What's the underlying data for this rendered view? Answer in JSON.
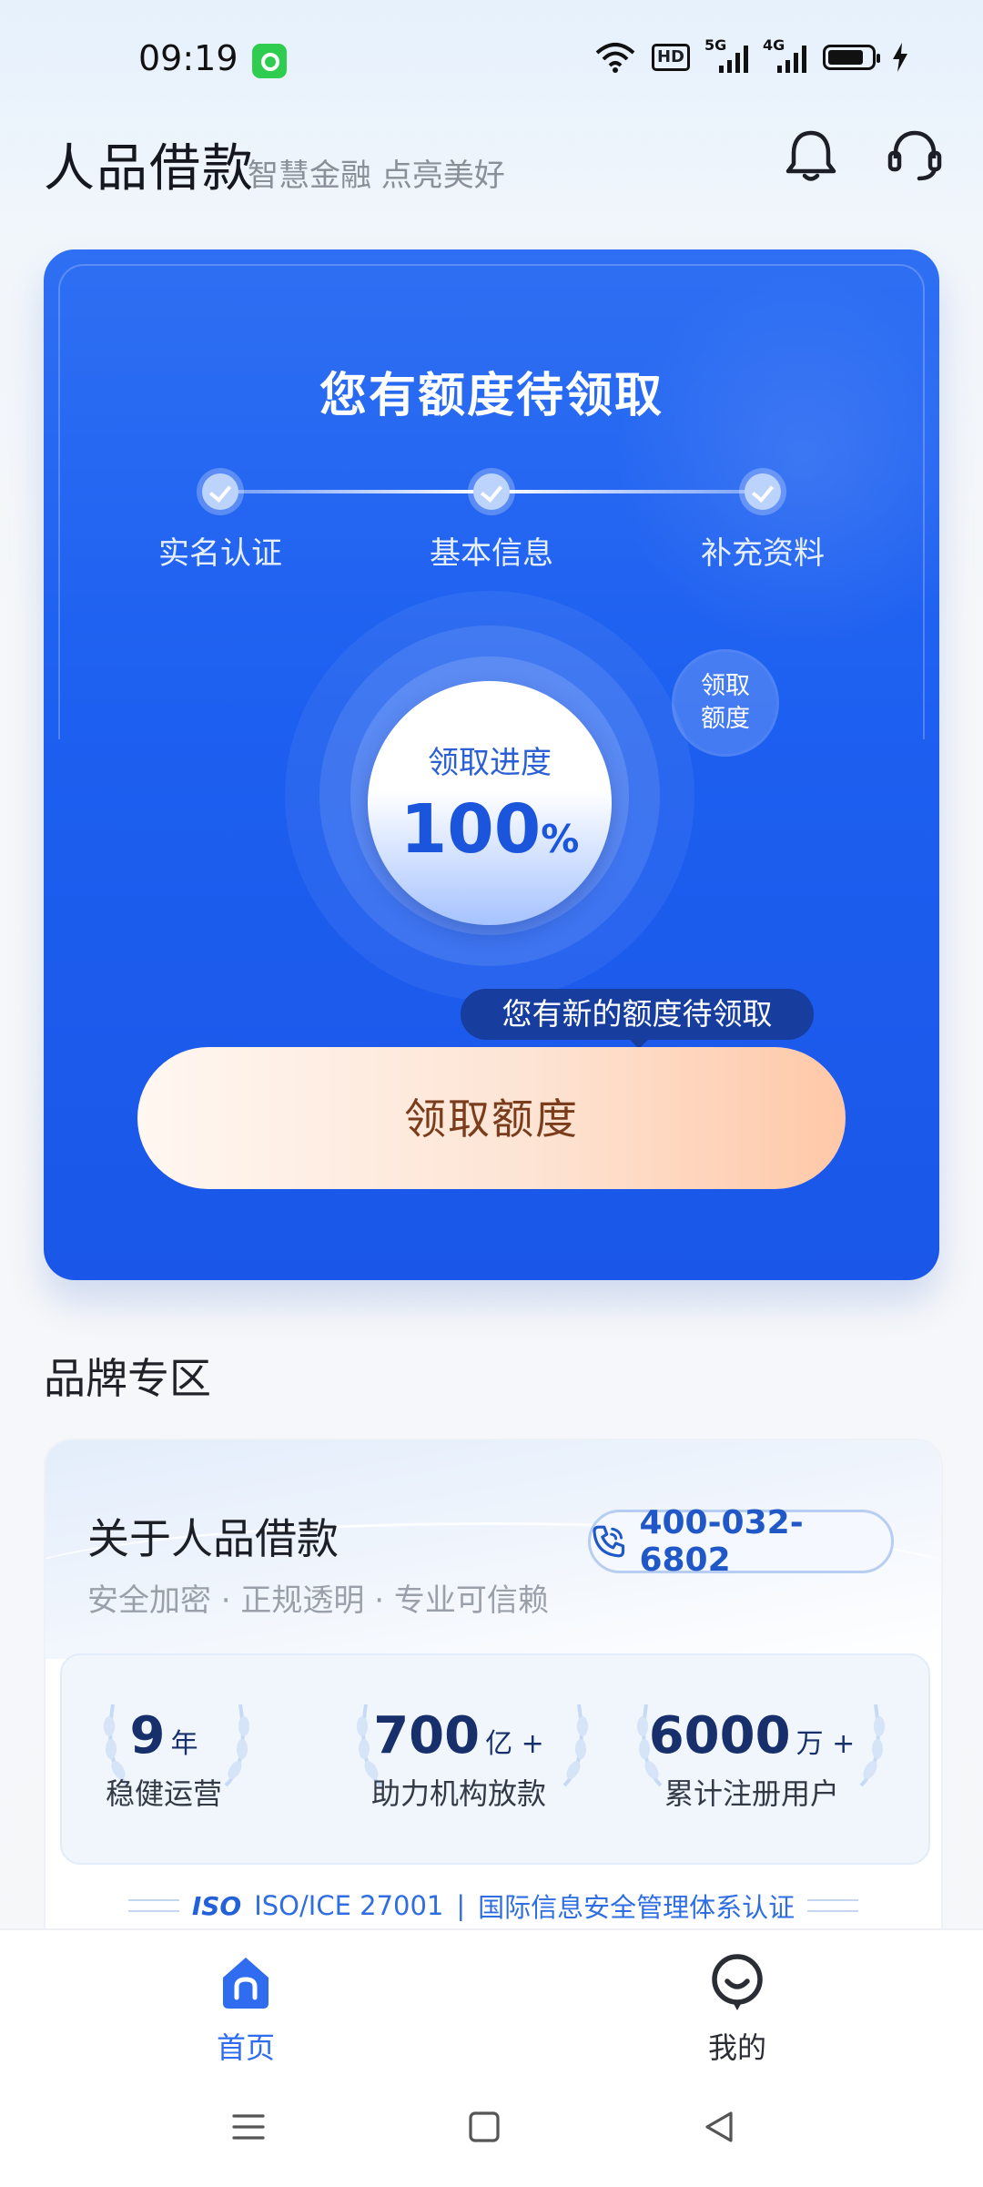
{
  "status_bar": {
    "time": "09:19",
    "signal1_label": "5G",
    "signal2_label": "4G",
    "hd_label": "HD"
  },
  "header": {
    "title": "人品借款",
    "slogan": "智慧金融 点亮美好"
  },
  "hero": {
    "title": "您有额度待领取",
    "steps": [
      {
        "label": "实名认证",
        "done": true
      },
      {
        "label": "基本信息",
        "done": true
      },
      {
        "label": "补充资料",
        "done": true
      }
    ],
    "progress_label": "领取进度",
    "progress_value": "100",
    "progress_unit": "%",
    "progress_fraction": 1.0,
    "bubble_label": "领取额度",
    "tooltip": "您有新的额度待领取",
    "claim_button": "领取额度"
  },
  "brand": {
    "section_title": "品牌专区",
    "about_title": "关于人品借款",
    "about_sub": "安全加密 · 正规透明 · 专业可信赖",
    "phone": "400-032-6802",
    "stats": [
      {
        "value": "9",
        "unit": "年",
        "label": "稳健运营"
      },
      {
        "value": "700",
        "unit": "亿 +",
        "label": "助力机构放款"
      },
      {
        "value": "6000",
        "unit": "万 +",
        "label": "累计注册用户"
      }
    ],
    "iso_badge": "ISO",
    "iso_text": "ISO/ICE 27001",
    "iso_separator": "|",
    "iso_desc": "国际信息安全管理体系认证"
  },
  "nav": {
    "items": [
      {
        "label": "首页",
        "active": true,
        "icon": "home-icon"
      },
      {
        "label": "我的",
        "active": false,
        "icon": "profile-icon"
      }
    ]
  },
  "colors": {
    "primary": "#1d5ff0",
    "accent_text": "#2158c8",
    "claim_text": "#7a3c1a"
  }
}
